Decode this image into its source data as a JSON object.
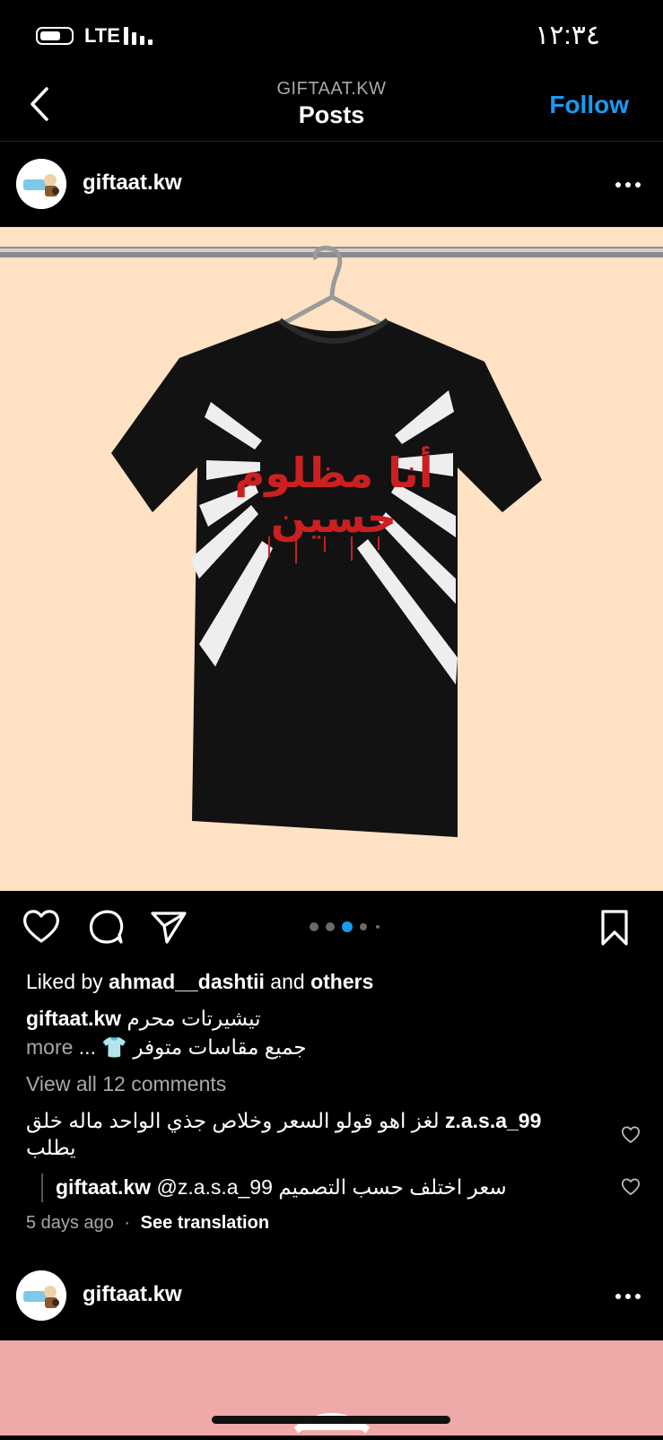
{
  "status_bar": {
    "network": "LTE",
    "time": "١٢:٣٤",
    "battery_icon": "battery-icon",
    "signal_icon": "signal-bars-icon"
  },
  "header": {
    "account": "GIFTAAT.KW",
    "title": "Posts",
    "follow_label": "Follow",
    "back_icon": "chevron-left-icon",
    "follow_color": "#1a9af2"
  },
  "post": {
    "username": "giftaat.kw",
    "image_description_icon": "tshirt-photo",
    "image_bg": "#fee2c3",
    "shirt_text_line1": "أنا مظلوم",
    "shirt_text_line2": "حسين",
    "carousel": {
      "count": 5,
      "active_index": 2
    },
    "actions": [
      "heart-icon",
      "comment-icon",
      "share-icon",
      "bookmark-icon"
    ],
    "likes": {
      "prefix": "Liked by",
      "user": "ahmad__dashtii",
      "middle": "and",
      "suffix": "others"
    },
    "caption": {
      "user": "giftaat.kw",
      "line1": "تيشيرتات محرم",
      "line2": "جميع مقاسات متوفر 👕 ...",
      "more": "more"
    },
    "view_comments": "View all 12 comments",
    "comments": [
      {
        "user": "z.a.s.a_99",
        "text": "لغز اهو قولو السعر وخلاص جذي الواحد ماله خلق يطلب"
      },
      {
        "user": "giftaat.kw",
        "mention": "@z.a.s.a_99",
        "text": "سعر اختلف حسب التصميم"
      }
    ],
    "time_ago": "5 days ago",
    "separator": "·",
    "see_translation": "See translation"
  },
  "next_post": {
    "username": "giftaat.kw",
    "image_bg": "#efa9a8"
  }
}
